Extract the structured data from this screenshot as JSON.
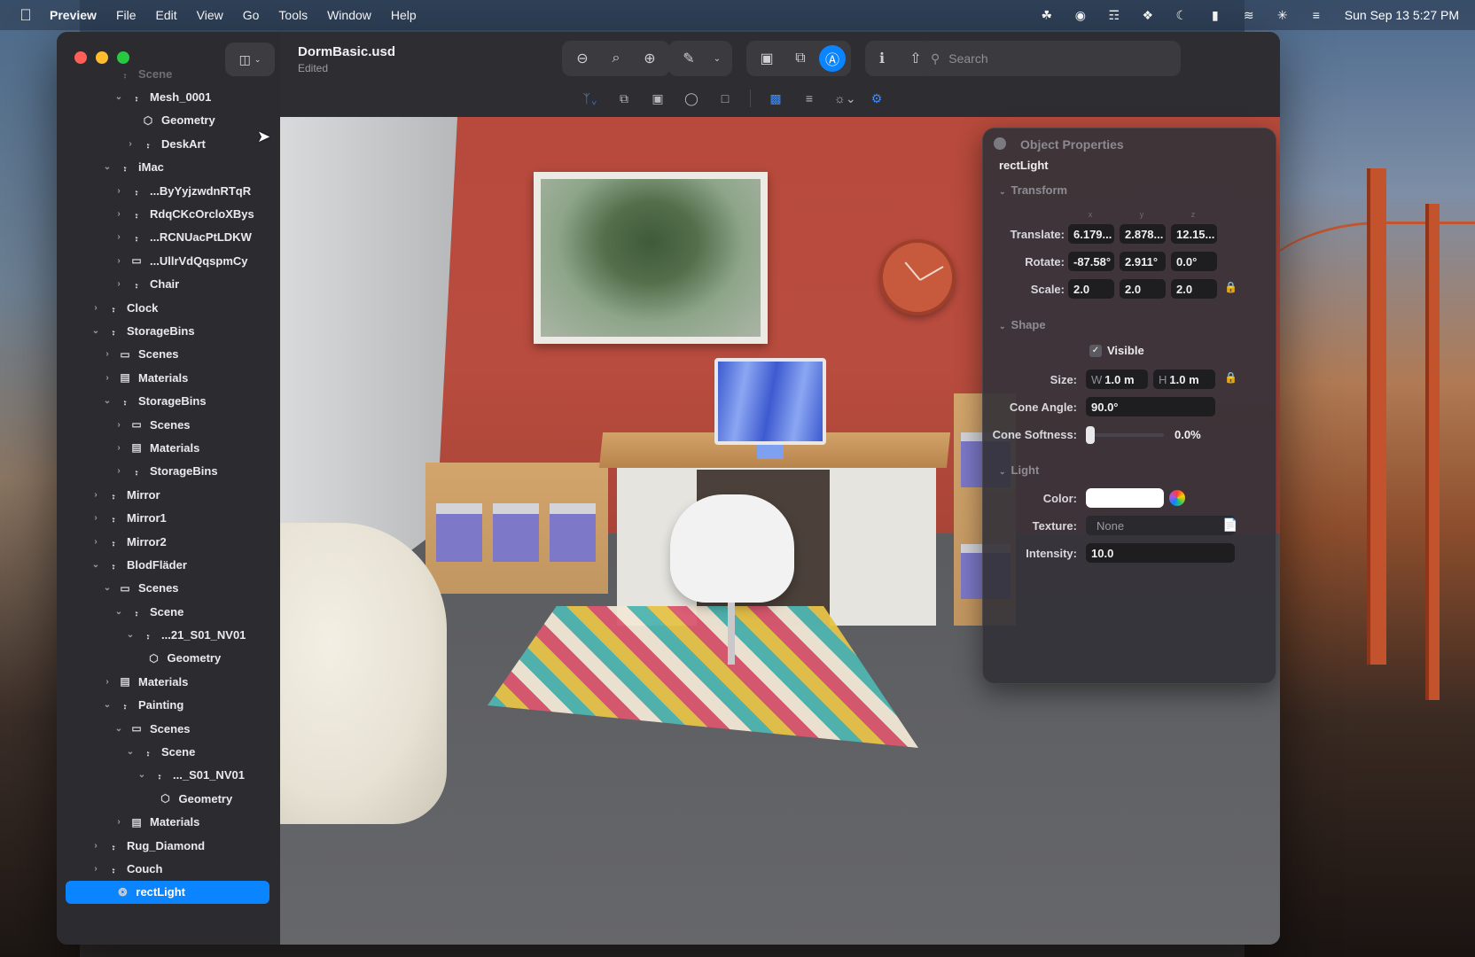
{
  "menubar": {
    "app_name": "Preview",
    "items": [
      "File",
      "Edit",
      "View",
      "Go",
      "Tools",
      "Window",
      "Help"
    ],
    "status_icons": [
      "creative-cloud-icon",
      "record-icon",
      "scanner-icon",
      "dropbox-icon",
      "moon-icon",
      "battery-icon",
      "wifi-icon",
      "bluetooth-icon",
      "control-center-icon"
    ],
    "clock": "Sun Sep 13  5:27 PM"
  },
  "window": {
    "document_title": "DormBasic.usd",
    "document_status": "Edited",
    "search_placeholder": "Search"
  },
  "sidebar": {
    "items": [
      {
        "label": "Scene",
        "indent": 1,
        "chevron": "",
        "icon": "node-icon",
        "faded": true
      },
      {
        "label": "Mesh_0001",
        "indent": 2,
        "chevron": "down",
        "icon": "node-icon"
      },
      {
        "label": "Geometry",
        "indent": 3,
        "chevron": "",
        "icon": "cube-icon"
      },
      {
        "label": "DeskArt",
        "indent": 3,
        "chevron": "right",
        "icon": "node-icon"
      },
      {
        "label": "iMac",
        "indent": 1,
        "chevron": "down",
        "icon": "node-icon"
      },
      {
        "label": "...ByYyjzwdnRTqR",
        "indent": 2,
        "chevron": "right",
        "icon": "node-icon"
      },
      {
        "label": "RdqCKcOrcloXBys",
        "indent": 2,
        "chevron": "right",
        "icon": "node-icon"
      },
      {
        "label": "...RCNUacPtLDKW",
        "indent": 2,
        "chevron": "right",
        "icon": "node-icon"
      },
      {
        "label": "...UllrVdQqspmCy",
        "indent": 2,
        "chevron": "right",
        "icon": "folder-icon"
      },
      {
        "label": "Chair",
        "indent": 2,
        "chevron": "right",
        "icon": "node-icon"
      },
      {
        "label": "Clock",
        "indent": 0,
        "chevron": "right",
        "icon": "node-icon"
      },
      {
        "label": "StorageBins",
        "indent": 0,
        "chevron": "down",
        "icon": "node-icon"
      },
      {
        "label": "Scenes",
        "indent": 1,
        "chevron": "right",
        "icon": "folder-icon"
      },
      {
        "label": "Materials",
        "indent": 1,
        "chevron": "right",
        "icon": "materials-icon"
      },
      {
        "label": "StorageBins",
        "indent": 1,
        "chevron": "down",
        "icon": "node-icon"
      },
      {
        "label": "Scenes",
        "indent": 2,
        "chevron": "right",
        "icon": "folder-icon"
      },
      {
        "label": "Materials",
        "indent": 2,
        "chevron": "right",
        "icon": "materials-icon"
      },
      {
        "label": "StorageBins",
        "indent": 2,
        "chevron": "right",
        "icon": "node-icon"
      },
      {
        "label": "Mirror",
        "indent": 0,
        "chevron": "right",
        "icon": "node-icon"
      },
      {
        "label": "Mirror1",
        "indent": 0,
        "chevron": "right",
        "icon": "node-icon"
      },
      {
        "label": "Mirror2",
        "indent": 0,
        "chevron": "right",
        "icon": "node-icon"
      },
      {
        "label": "BlodFläder",
        "indent": 0,
        "chevron": "down",
        "icon": "node-icon"
      },
      {
        "label": "Scenes",
        "indent": 1,
        "chevron": "down",
        "icon": "folder-icon"
      },
      {
        "label": "Scene",
        "indent": 2,
        "chevron": "down",
        "icon": "node-icon"
      },
      {
        "label": "...21_S01_NV01",
        "indent": 3,
        "chevron": "down",
        "icon": "node-icon"
      },
      {
        "label": "Geometry",
        "indent": 3.5,
        "chevron": "",
        "icon": "cube-icon"
      },
      {
        "label": "Materials",
        "indent": 1,
        "chevron": "right",
        "icon": "materials-icon"
      },
      {
        "label": "Painting",
        "indent": 1,
        "chevron": "down",
        "icon": "node-icon"
      },
      {
        "label": "Scenes",
        "indent": 2,
        "chevron": "down",
        "icon": "folder-icon"
      },
      {
        "label": "Scene",
        "indent": 3,
        "chevron": "down",
        "icon": "node-icon"
      },
      {
        "label": "..._S01_NV01",
        "indent": 4,
        "chevron": "down",
        "icon": "node-icon"
      },
      {
        "label": "Geometry",
        "indent": 4.5,
        "chevron": "",
        "icon": "cube-icon"
      },
      {
        "label": "Materials",
        "indent": 2,
        "chevron": "right",
        "icon": "materials-icon"
      },
      {
        "label": "Rug_Diamond",
        "indent": 0,
        "chevron": "right",
        "icon": "node-icon"
      },
      {
        "label": "Couch",
        "indent": 0,
        "chevron": "right",
        "icon": "node-icon"
      },
      {
        "label": "rectLight",
        "indent": 0.8,
        "chevron": "",
        "icon": "light-bulb-icon",
        "selected": true
      }
    ]
  },
  "properties": {
    "title": "Object Properties",
    "object_name": "rectLight",
    "transform": {
      "section": "Transform",
      "axes": [
        "x",
        "y",
        "z"
      ],
      "translate_label": "Translate:",
      "translate": [
        "6.179...",
        "2.878...",
        "12.15..."
      ],
      "rotate_label": "Rotate:",
      "rotate": [
        "-87.58°",
        "2.911°",
        "0.0°"
      ],
      "scale_label": "Scale:",
      "scale": [
        "2.0",
        "2.0",
        "2.0"
      ]
    },
    "shape": {
      "section": "Shape",
      "visible_label": "Visible",
      "visible": true,
      "size_label": "Size:",
      "width_prefix": "W",
      "width": "1.0 m",
      "height_prefix": "H",
      "height": "1.0 m",
      "cone_angle_label": "Cone Angle:",
      "cone_angle": "90.0°",
      "cone_softness_label": "Cone Softness:",
      "cone_softness": "0.0%",
      "cone_softness_value": 0.0
    },
    "light": {
      "section": "Light",
      "color_label": "Color:",
      "color": "#ffffff",
      "texture_label": "Texture:",
      "texture": "None",
      "intensity_label": "Intensity:",
      "intensity": "10.0"
    }
  },
  "colors": {
    "accent": "#0a84ff",
    "wall": "#b74a3c"
  }
}
